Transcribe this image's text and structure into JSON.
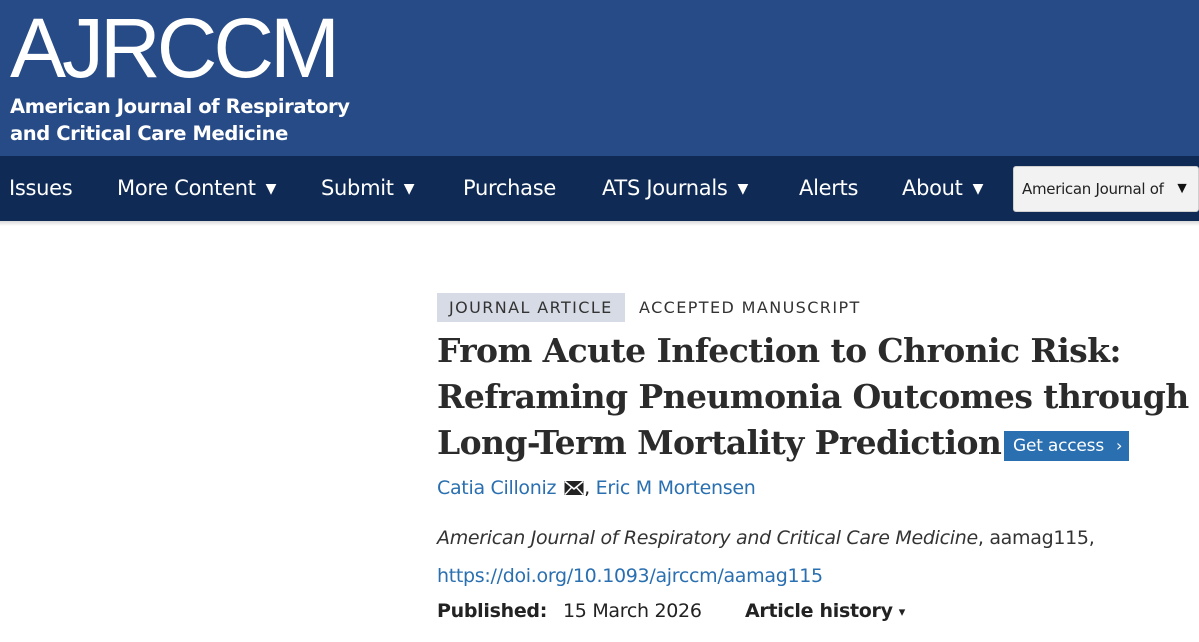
{
  "header": {
    "logo_mark": "AJRCCM",
    "logo_line1": "American Journal of Respiratory",
    "logo_line2": "and Critical Care Medicine",
    "bg_color": "#274b87"
  },
  "nav": {
    "bg_color": "#0e2a55",
    "items": [
      {
        "label": "Issues",
        "has_dropdown": false
      },
      {
        "label": "More Content",
        "has_dropdown": true
      },
      {
        "label": "Submit",
        "has_dropdown": true
      },
      {
        "label": "Purchase",
        "has_dropdown": false
      },
      {
        "label": "ATS Journals",
        "has_dropdown": true
      },
      {
        "label": "Alerts",
        "has_dropdown": false
      },
      {
        "label": "About",
        "has_dropdown": true
      }
    ],
    "caret": "▼",
    "journal_select_value": "American Journal of",
    "journal_select_arrow": "▼"
  },
  "article": {
    "type_badge": "JOURNAL ARTICLE",
    "status": "ACCEPTED MANUSCRIPT",
    "title_lines": [
      "From Acute Infection to Chronic Risk:",
      "Reframing Pneumonia Outcomes through",
      "Long-Term Mortality Prediction"
    ],
    "get_access_label": "Get access",
    "get_access_chevron": "›",
    "authors": [
      {
        "name": "Catia Cilloniz",
        "has_email_icon": true
      },
      {
        "name": "Eric M Mortensen",
        "has_email_icon": false
      }
    ],
    "author_separator": ",",
    "journal_name": "American Journal of Respiratory and Critical Care Medicine",
    "article_id": ", aamag115,",
    "doi": "https://doi.org/10.1093/ajrccm/aamag115",
    "published_label": "Published:",
    "published_date": "15 March 2026",
    "history_label": "Article history",
    "history_caret": "▾",
    "link_color": "#2a6fb0"
  }
}
